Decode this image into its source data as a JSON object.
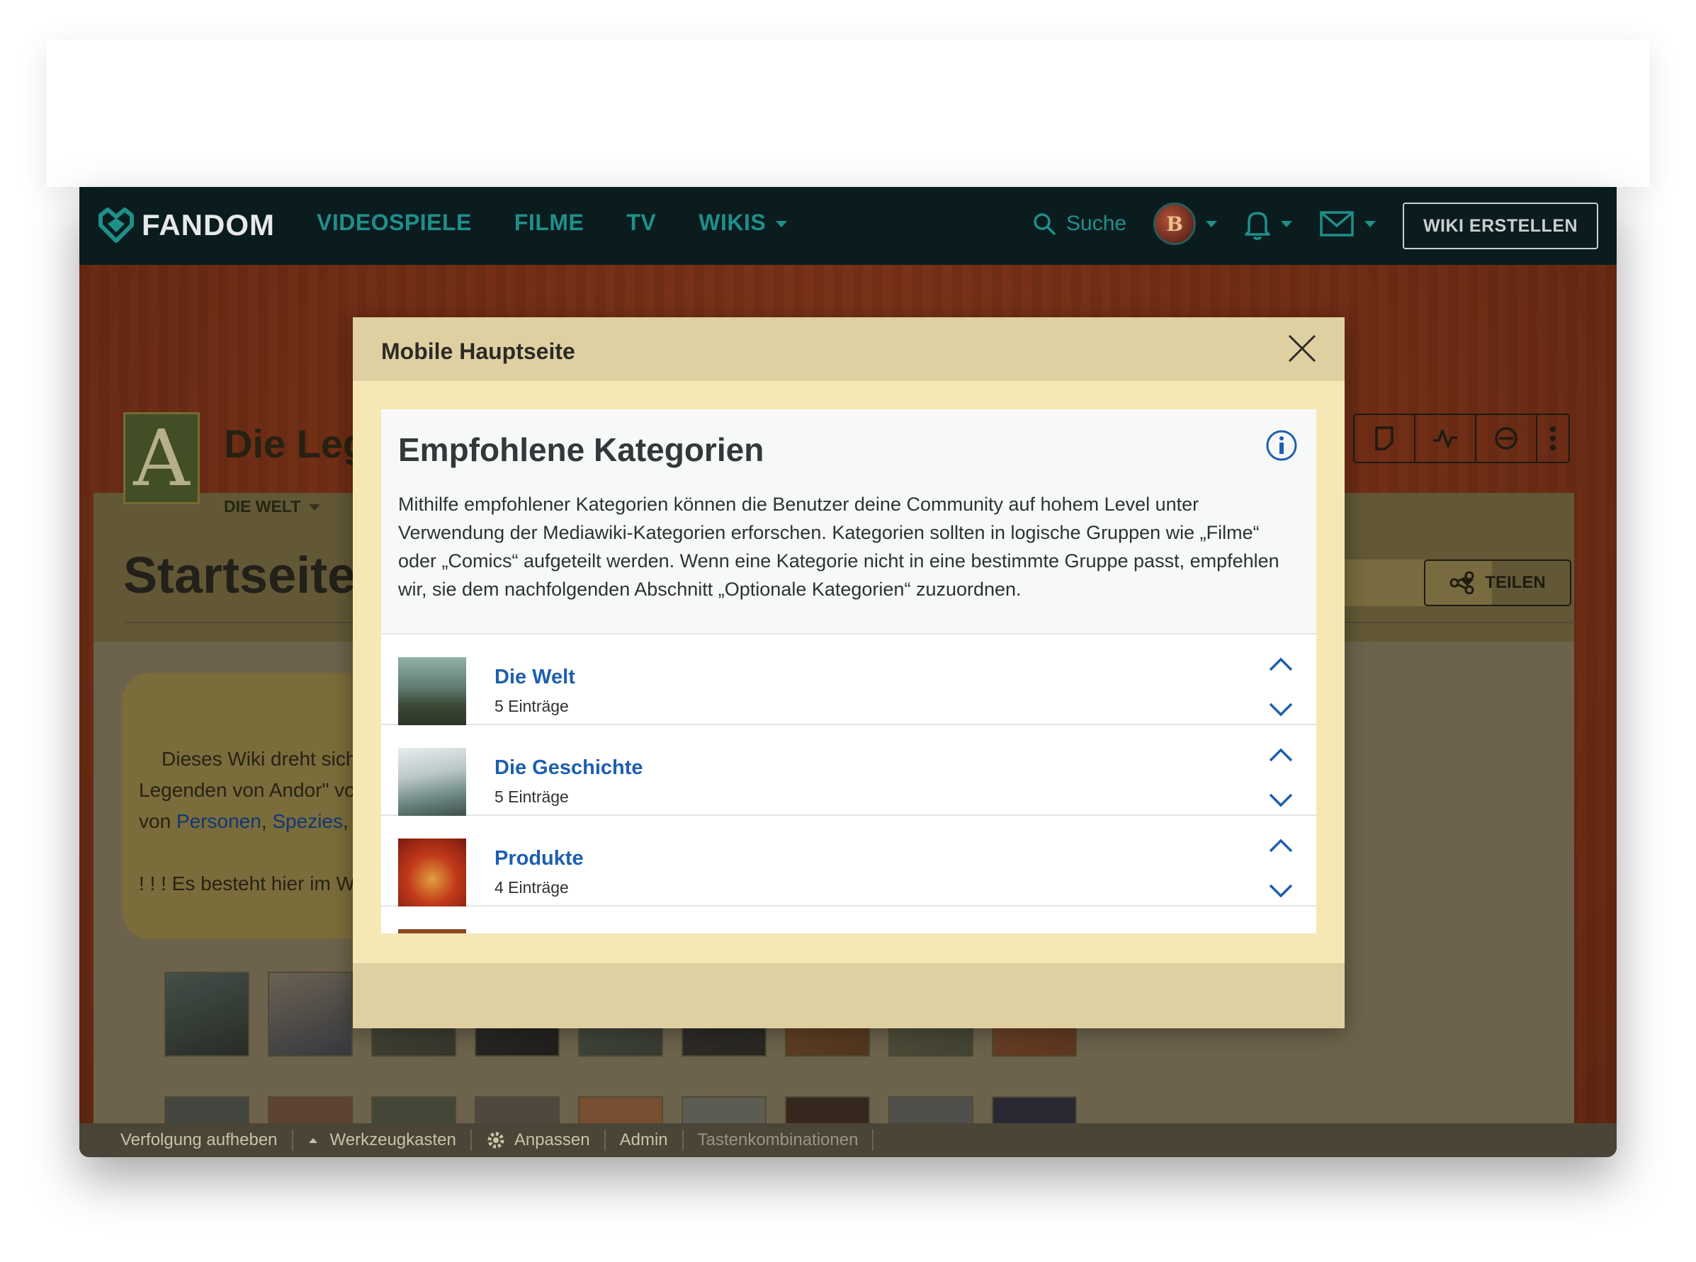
{
  "nav": {
    "logo": "FANDOM",
    "links": [
      "VIDEOSPIELE",
      "FILME",
      "TV",
      "WIKIS"
    ],
    "search": "Suche",
    "avatar_letter": "B",
    "create_wiki": "WIKI ERSTELLEN"
  },
  "wiki": {
    "logo_letter": "A",
    "title": "Die Leg",
    "subnav": "DIE WELT"
  },
  "page": {
    "title": "Startseite",
    "share": "TEILEN",
    "intro_lines": [
      "Dieses Wiki dreht sich",
      "Legenden von Andor\" vo"
    ],
    "intro_line3_prefix": "von ",
    "intro_link1": "Personen",
    "intro_sep": ", ",
    "intro_link2": "Spezies",
    "intro_line3_suffix": ",",
    "intro_line4": "! ! ! Es besteht hier im W"
  },
  "toolbar": {
    "items": [
      "Verfolgung aufheben",
      "Werkzeugkasten",
      "Anpassen",
      "Admin",
      "Tastenkombinationen"
    ]
  },
  "modal": {
    "title": "Mobile Hauptseite",
    "heading": "Empfohlene Kategorien",
    "description": "Mithilfe empfohlener Kategorien können die Benutzer deine Community auf hohem Level unter Verwendung der Mediawiki-Kategorien erforschen. Kategorien sollten in logische Gruppen wie „Filme“ oder „Comics“ aufgeteilt werden. Wenn eine Kategorie nicht in eine bestimmte Gruppe passt, empfehlen wir, sie dem nachfolgenden Abschnitt „Optionale Kategorien“ zuzuordnen.",
    "categories": [
      {
        "name": "Die Welt",
        "count": "5 Einträge"
      },
      {
        "name": "Die Geschichte",
        "count": "5 Einträge"
      },
      {
        "name": "Produkte",
        "count": "4 Einträge"
      }
    ]
  },
  "colors": {
    "fandom_nav": "#0b1c1e",
    "fandom_accent": "#1f8f8a",
    "modal_bg": "#f6e8b4",
    "modal_head": "#dfd0a2",
    "link_blue": "#1e5fb0"
  }
}
